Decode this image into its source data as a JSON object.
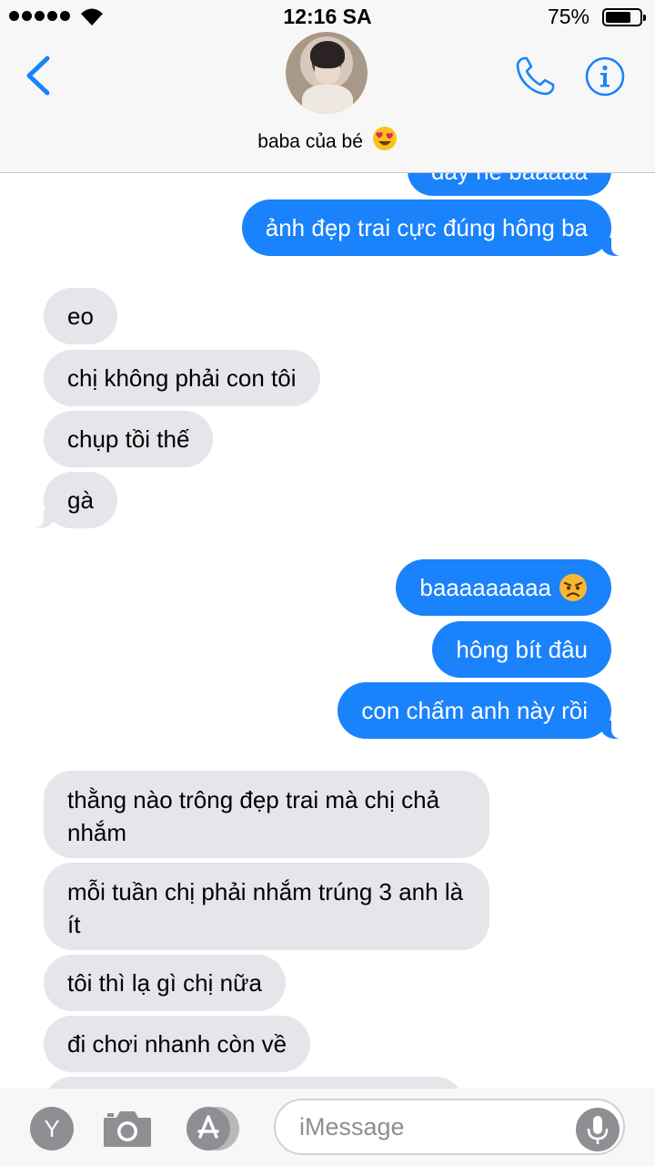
{
  "status": {
    "time": "12:16 SA",
    "battery": "75%",
    "battery_level": 0.75
  },
  "header": {
    "contact_name": "baba của bé"
  },
  "messages": [
    {
      "side": "out",
      "text": "đây nè baaaaa"
    },
    {
      "side": "out",
      "text": "ảnh đẹp trai cực đúng hông ba"
    },
    {
      "side": "in",
      "text": "eo"
    },
    {
      "side": "in",
      "text": "chị không phải con tôi"
    },
    {
      "side": "in",
      "text": "chụp tồi thế"
    },
    {
      "side": "in",
      "text": "gà"
    },
    {
      "side": "out",
      "text": "baaaaaaaaa"
    },
    {
      "side": "out",
      "text": "hông bít đâu"
    },
    {
      "side": "out",
      "text": "con chấm anh này rồi"
    },
    {
      "side": "in",
      "text": "thằng nào trông đẹp trai mà chị chả nhắm"
    },
    {
      "side": "in",
      "text": "mỗi tuần chị phải nhắm trúng 3 anh là ít"
    },
    {
      "side": "in",
      "text": "tôi thì lạ gì chị nữa"
    },
    {
      "side": "in",
      "text": "đi chơi nhanh còn về"
    }
  ],
  "input_bar": {
    "y_label": "Y",
    "placeholder": "iMessage"
  },
  "icons": {
    "back": "chevron-left-icon",
    "call": "phone-icon",
    "info": "info-icon",
    "camera": "camera-icon",
    "apps": "app-store-icon",
    "mic": "microphone-icon",
    "emoji_heart_eyes": "heart-eyes-emoji",
    "emoji_angry": "angry-emoji"
  },
  "colors": {
    "accent": "#1a82fb",
    "incoming": "#e5e5ea",
    "gray": "#8e8e93"
  }
}
